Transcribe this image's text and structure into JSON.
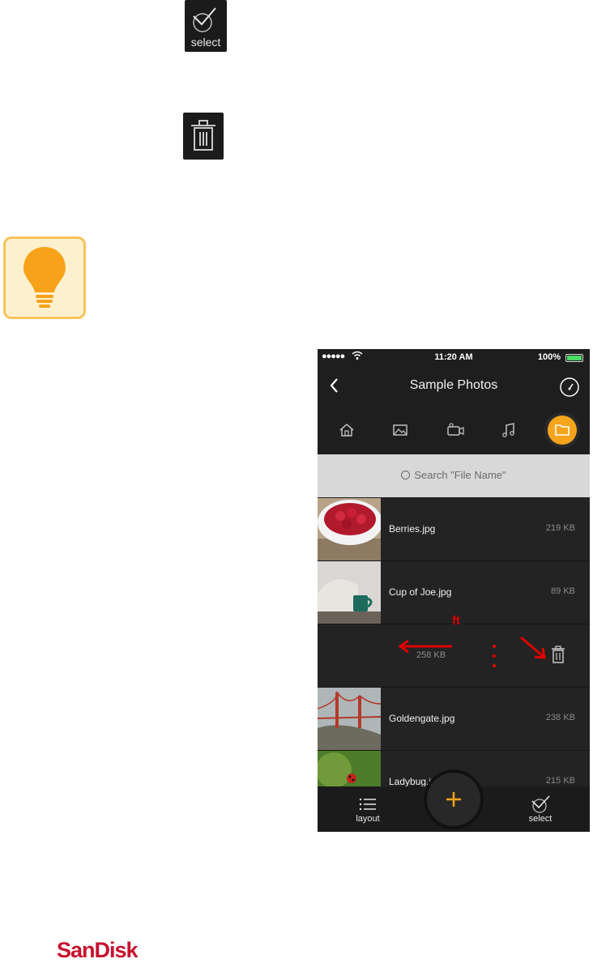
{
  "legend": {
    "select_label": "select"
  },
  "phone": {
    "status": {
      "signal": "●●●●●",
      "time": "11:20 AM",
      "battery": "100%"
    },
    "nav": {
      "title": "Sample Photos"
    },
    "search": {
      "placeholder": "Search \"File Name\""
    },
    "files": [
      {
        "name": "Berries.jpg",
        "size": "219 KB"
      },
      {
        "name": "Cup of Joe.jpg",
        "size": "89 KB"
      },
      {
        "name": "",
        "size": "258 KB"
      },
      {
        "name": "Goldengate.jpg",
        "size": "238 KB"
      },
      {
        "name": "Ladybug.jp",
        "size": "215 KB"
      }
    ],
    "bottom": {
      "layout_label": "layout",
      "select_label": "select"
    }
  },
  "annotation": {
    "text": "ft"
  },
  "brand": {
    "name": "SanDisk"
  },
  "colors": {
    "accent": "#f4a51c",
    "annotation": "#e00000",
    "brand": "#c8102e"
  }
}
